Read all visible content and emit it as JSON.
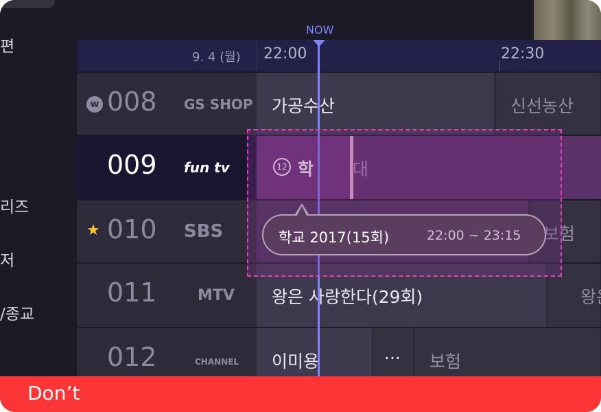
{
  "sidebar": {
    "items": [
      {
        "label": "편"
      },
      {
        "label": "리즈"
      },
      {
        "label": "저"
      },
      {
        "label": "/종교"
      }
    ]
  },
  "guide": {
    "now_label": "NOW",
    "date": "9. 4 (월)",
    "times": [
      "22:00",
      "22:30"
    ]
  },
  "channels": [
    {
      "number": "008",
      "logo": "GS SHOP",
      "icon": "w-badge-icon"
    },
    {
      "number": "009",
      "logo": "fun tv",
      "icon": ""
    },
    {
      "number": "010",
      "logo": "SBS",
      "icon": "star-icon"
    },
    {
      "number": "011",
      "logo": "MTV",
      "icon": ""
    },
    {
      "number": "012",
      "logo": "CHANNEL",
      "icon": ""
    }
  ],
  "programs": {
    "row008": [
      "가공수산",
      "신선농산"
    ],
    "row009": {
      "rating": "12",
      "focused_title": "학",
      "next_title": "대"
    },
    "row010": [
      "보험"
    ],
    "row011": [
      "왕은 사랑한다(29회)",
      "왕은"
    ],
    "row012": [
      "이미용",
      "···",
      "보험"
    ]
  },
  "tooltip": {
    "title": "학교 2017(15회)",
    "time": "22:00 ~ 23:15"
  },
  "banner": {
    "label": "Don’t"
  },
  "colors": {
    "now": "#7d86ff",
    "focus": "#6b3479",
    "banner": "#fc3537",
    "dash": "#f03ab7"
  }
}
